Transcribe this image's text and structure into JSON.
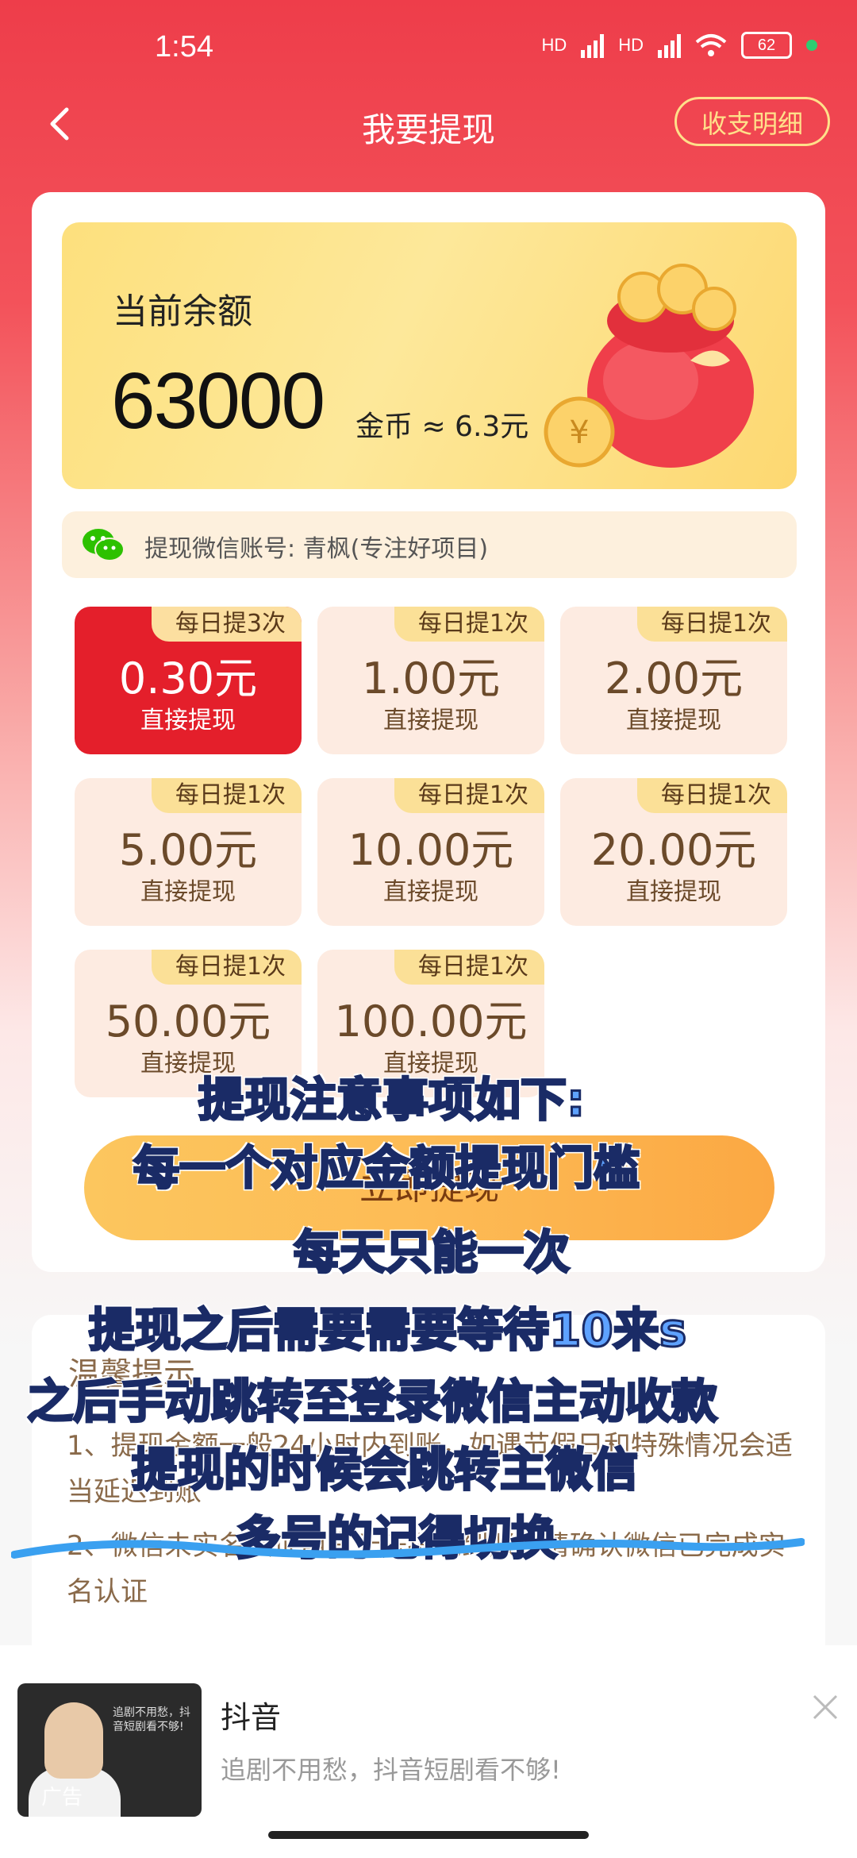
{
  "status_bar": {
    "time": "1:54",
    "battery": "62",
    "net1": "HD",
    "net2": "HD"
  },
  "header": {
    "title": "我要提现",
    "ledger_button": "收支明细"
  },
  "balance": {
    "label": "当前余额",
    "amount": "63000",
    "unit": "金币 ≈ 6.3元"
  },
  "wechat": {
    "account_text": "提现微信账号: 青枫(专注好项目)"
  },
  "options": [
    {
      "limit": "每日提3次",
      "amount": "0.30元",
      "action": "直接提现",
      "selected": true
    },
    {
      "limit": "每日提1次",
      "amount": "1.00元",
      "action": "直接提现",
      "selected": false
    },
    {
      "limit": "每日提1次",
      "amount": "2.00元",
      "action": "直接提现",
      "selected": false
    },
    {
      "limit": "每日提1次",
      "amount": "5.00元",
      "action": "直接提现",
      "selected": false
    },
    {
      "limit": "每日提1次",
      "amount": "10.00元",
      "action": "直接提现",
      "selected": false
    },
    {
      "limit": "每日提1次",
      "amount": "20.00元",
      "action": "直接提现",
      "selected": false
    },
    {
      "limit": "每日提1次",
      "amount": "50.00元",
      "action": "直接提现",
      "selected": false
    },
    {
      "limit": "每日提1次",
      "amount": "100.00元",
      "action": "直接提现",
      "selected": false
    }
  ],
  "withdraw_button": "立即提现",
  "tips": {
    "title": "温馨提示",
    "item1": "1、提现金额一般24小时内到账，如遇节假日和特殊情况会适当延迟到账",
    "item2": "2、微信未实名认证用户无法提现到账，请确认微信已完成实名认证"
  },
  "overlay_lines": [
    "提现注意事项如下:",
    "每一个对应金额提现门槛",
    "每天只能一次",
    "提现之后需要需要等待10来s",
    "之后手动跳转至登录微信主动收款",
    "提现的时候会跳转主微信",
    "多号的记得切换"
  ],
  "ad": {
    "app_name": "抖音",
    "description": "追剧不用愁，抖音短剧看不够!",
    "label": "广告",
    "thumb_text": "追剧不用愁，抖音短剧看不够!"
  },
  "colors": {
    "accent_red": "#e41f2b",
    "gold": "#fdc55e",
    "header_red": "#ee3d4a"
  }
}
